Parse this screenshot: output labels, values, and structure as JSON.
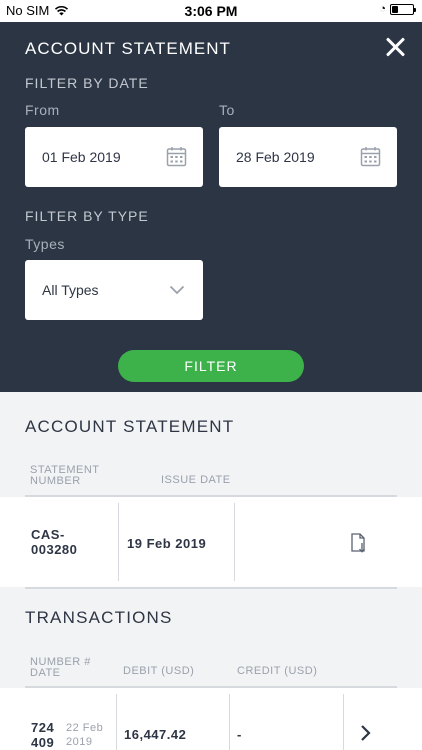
{
  "status_bar": {
    "carrier": "No SIM",
    "time": "3:06 PM"
  },
  "filter_panel": {
    "title": "ACCOUNT STATEMENT",
    "filter_by_date_label": "FILTER BY DATE",
    "from_label": "From",
    "from_value": "01 Feb 2019",
    "to_label": "To",
    "to_value": "28 Feb 2019",
    "filter_by_type_label": "FILTER BY TYPE",
    "types_label": "Types",
    "types_value": "All Types",
    "filter_button_label": "FILTER"
  },
  "statement": {
    "heading": "ACCOUNT STATEMENT",
    "columns": [
      "STATEMENT NUMBER",
      "ISSUE DATE"
    ],
    "rows": [
      {
        "number": "CAS-\n003280",
        "issue_date": "19 Feb 2019",
        "action_icon": "download-document-icon"
      }
    ]
  },
  "transactions": {
    "heading": "TRANSACTIONS",
    "columns": [
      "NUMBER # DATE",
      "DEBIT (USD)",
      "CREDIT (USD)"
    ],
    "rows": [
      {
        "number": "724\n409",
        "date": "22 Feb\n2019",
        "debit": "16,447.42",
        "credit": "-"
      }
    ]
  },
  "colors": {
    "panel_bg": "#2b3544",
    "accent_green": "#3db14a",
    "page_bg": "#f2f3f5"
  }
}
